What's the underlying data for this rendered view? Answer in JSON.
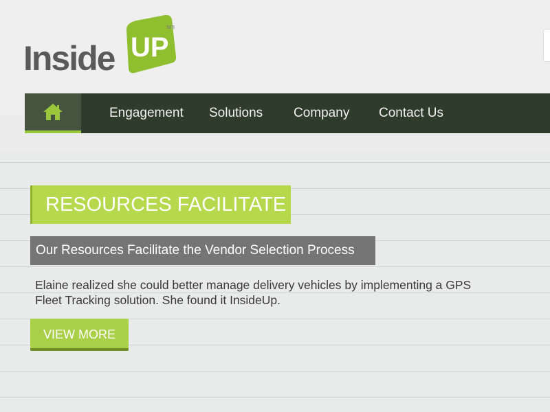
{
  "brand": {
    "logo_word": "Inside",
    "logo_badge": "UP",
    "logo_mark": "sm",
    "colors": {
      "green": "#a9d048",
      "dark_nav": "#2f3b2b",
      "gray_label": "#757575"
    }
  },
  "nav": {
    "home_icon": "home-icon",
    "items": [
      "Engagement",
      "Solutions",
      "Company",
      "Contact Us"
    ]
  },
  "hero": {
    "badge": "RESOURCES FACILITATE",
    "subtitle": "Our Resources Facilitate the Vendor Selection Process",
    "body_line1": "Elaine realized she could better manage delivery vehicles by implementing a GPS",
    "body_line2": "Fleet Tracking solution. She found it InsideUp.",
    "button_label": "VIEW MORE"
  }
}
